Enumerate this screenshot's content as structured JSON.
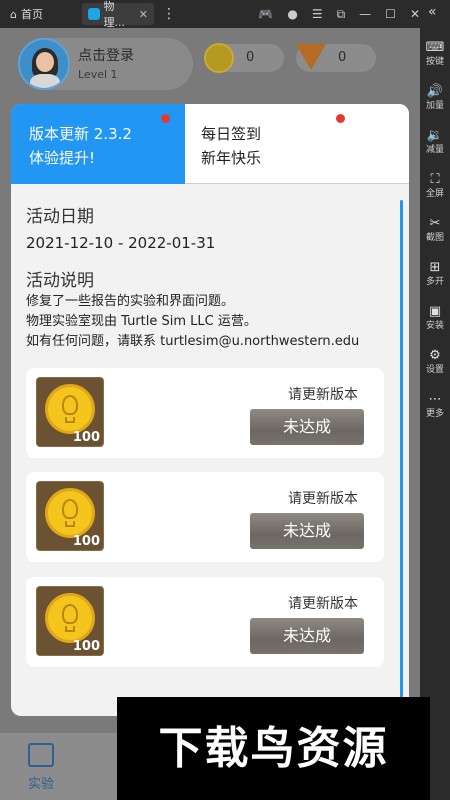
{
  "window": {
    "home_tab": "首页",
    "app_tab": "物理...",
    "right_sidebar": [
      {
        "icon": "keyboard-icon",
        "label": "按键"
      },
      {
        "icon": "volume-up-icon",
        "label": "加量"
      },
      {
        "icon": "volume-down-icon",
        "label": "减量"
      },
      {
        "icon": "fullscreen-icon",
        "label": "全屏"
      },
      {
        "icon": "scissors-icon",
        "label": "截图"
      },
      {
        "icon": "multi-instance-icon",
        "label": "多开"
      },
      {
        "icon": "apk-install-icon",
        "label": "安装"
      },
      {
        "icon": "settings-gear-icon",
        "label": "设置"
      },
      {
        "icon": "more-icon",
        "label": "更多"
      }
    ]
  },
  "header": {
    "login": "点击登录",
    "level": "Level 1",
    "coins": "0",
    "gems": "0"
  },
  "modal": {
    "tab_update": {
      "line1": "版本更新 2.3.2",
      "line2": "体验提升!"
    },
    "tab_checkin": {
      "line1": "每日签到",
      "line2": "新年快乐"
    },
    "date_heading": "活动日期",
    "date_range": "2021-12-10 - 2022-01-31",
    "desc_heading": "活动说明",
    "desc_lines": [
      "修复了一些报告的实验和界面问题。",
      "物理实验室现由 Turtle Sim LLC 运营。",
      "如有任何问题，请联系 turtlesim@u.northwestern.edu"
    ],
    "rewards": [
      {
        "qty": "100",
        "hint": "请更新版本",
        "button": "未达成"
      },
      {
        "qty": "100",
        "hint": "请更新版本",
        "button": "未达成"
      },
      {
        "qty": "100",
        "hint": "请更新版本",
        "button": "未达成"
      }
    ]
  },
  "bottom_nav": {
    "active_label": "实验"
  },
  "watermark": "下载鸟资源",
  "colors": {
    "accent": "#2196f3",
    "badge": "#e53935",
    "button": "#6c6762"
  }
}
